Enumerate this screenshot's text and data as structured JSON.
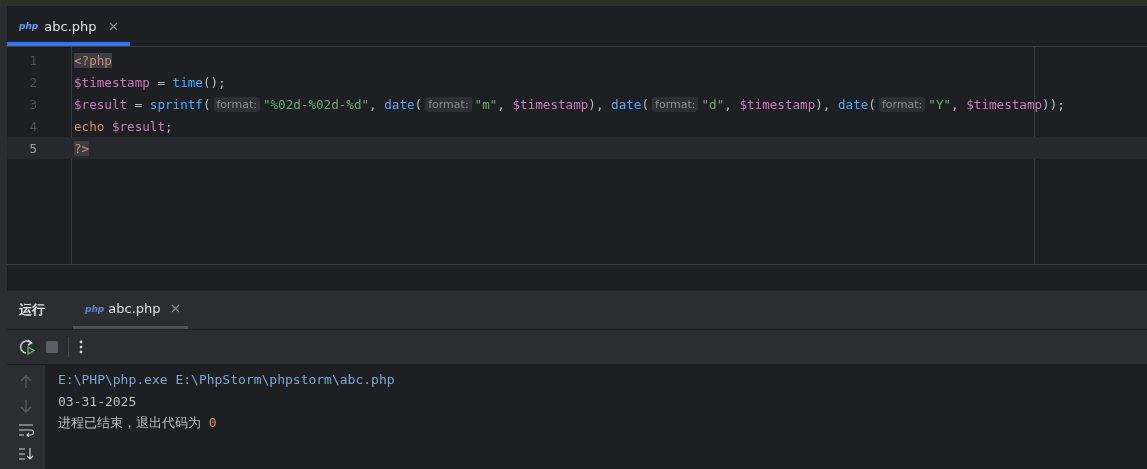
{
  "editor_tabs": [
    {
      "label": "abc.php",
      "icon_text": "php",
      "selected": true
    }
  ],
  "code_lines": [
    {
      "number": "1",
      "current": false,
      "tokens": [
        {
          "kind": "tag",
          "text": "<?php"
        }
      ]
    },
    {
      "number": "2",
      "current": false,
      "tokens": [
        {
          "kind": "var",
          "text": "$timestamp"
        },
        {
          "kind": "punct",
          "text": " = "
        },
        {
          "kind": "func",
          "text": "time"
        },
        {
          "kind": "punct",
          "text": "();"
        }
      ]
    },
    {
      "number": "3",
      "current": false,
      "tokens": [
        {
          "kind": "var",
          "text": "$result"
        },
        {
          "kind": "punct",
          "text": " = "
        },
        {
          "kind": "func",
          "text": "sprintf"
        },
        {
          "kind": "punct",
          "text": "("
        },
        {
          "kind": "hint",
          "text": "format:"
        },
        {
          "kind": "string",
          "text": "\"%02d-%02d-%d\""
        },
        {
          "kind": "punct",
          "text": ", "
        },
        {
          "kind": "func",
          "text": "date"
        },
        {
          "kind": "punct",
          "text": "("
        },
        {
          "kind": "hint",
          "text": "format:"
        },
        {
          "kind": "string",
          "text": "\"m\""
        },
        {
          "kind": "punct",
          "text": ", "
        },
        {
          "kind": "var",
          "text": "$timestamp"
        },
        {
          "kind": "punct",
          "text": "), "
        },
        {
          "kind": "func",
          "text": "date"
        },
        {
          "kind": "punct",
          "text": "("
        },
        {
          "kind": "hint",
          "text": "format:"
        },
        {
          "kind": "string",
          "text": "\"d\""
        },
        {
          "kind": "punct",
          "text": ", "
        },
        {
          "kind": "var",
          "text": "$timestamp"
        },
        {
          "kind": "punct",
          "text": "), "
        },
        {
          "kind": "func",
          "text": "date"
        },
        {
          "kind": "punct",
          "text": "("
        },
        {
          "kind": "hint",
          "text": "format:"
        },
        {
          "kind": "string",
          "text": "\"Y\""
        },
        {
          "kind": "punct",
          "text": ", "
        },
        {
          "kind": "var",
          "text": "$timestamp"
        },
        {
          "kind": "punct",
          "text": "));"
        }
      ]
    },
    {
      "number": "4",
      "current": false,
      "tokens": [
        {
          "kind": "keyword",
          "text": "echo "
        },
        {
          "kind": "var",
          "text": "$result"
        },
        {
          "kind": "punct",
          "text": ";"
        }
      ]
    },
    {
      "number": "5",
      "current": true,
      "tokens": [
        {
          "kind": "tag",
          "text": "?>"
        }
      ]
    }
  ],
  "run_panel": {
    "title": "运行",
    "tabs": [
      {
        "label": "abc.php",
        "icon_text": "php",
        "selected": true
      }
    ],
    "output": [
      {
        "kind": "command",
        "segments": [
          {
            "kind": "text",
            "text": "E:\\PHP\\php.exe E:\\PhpStorm\\phpstorm\\abc.php"
          }
        ]
      },
      {
        "kind": "stdout",
        "segments": [
          {
            "kind": "text",
            "text": "03-31-2025"
          }
        ]
      },
      {
        "kind": "system",
        "segments": [
          {
            "kind": "text",
            "text": "进程已结束，退出代码为 "
          },
          {
            "kind": "number",
            "text": "0"
          }
        ]
      }
    ]
  }
}
